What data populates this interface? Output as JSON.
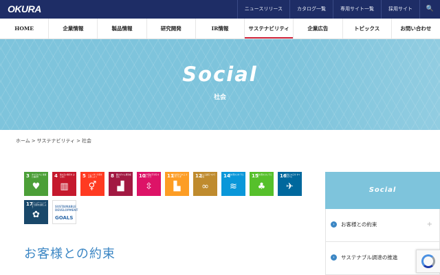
{
  "brand": {
    "logo": "OKURA"
  },
  "toplinks": [
    "ニュースリリース",
    "カタログ一覧",
    "専用サイト一覧",
    "採用サイト"
  ],
  "search_icon": "🔍",
  "nav": [
    "HOME",
    "企業情報",
    "製品情報",
    "研究開発",
    "IR情報",
    "サステナビリティ",
    "企業広告",
    "トピックス",
    "お問い合わせ"
  ],
  "hero": {
    "title": "Social",
    "subtitle": "社会"
  },
  "breadcrumb": [
    "ホーム",
    ">",
    "サステナビリティ",
    ">",
    "社会"
  ],
  "sdgs": [
    {
      "num": "3",
      "text": "すべての人に 健康と福祉を",
      "color": "#4c9f38",
      "icon": "heart-pulse-icon",
      "glyph": "♥"
    },
    {
      "num": "4",
      "text": "質の高い教育を みんなに",
      "color": "#c5192d",
      "icon": "book-icon",
      "glyph": "▥"
    },
    {
      "num": "5",
      "text": "ジェンダー平等を 実現しよう",
      "color": "#ff3a21",
      "icon": "gender-icon",
      "glyph": "⚥"
    },
    {
      "num": "8",
      "text": "働きがいも 経済成長も",
      "color": "#a21942",
      "icon": "growth-chart-icon",
      "glyph": "▟"
    },
    {
      "num": "10",
      "text": "人や国の不平等 をなくそう",
      "color": "#dd1367",
      "icon": "equality-icon",
      "glyph": "⇳"
    },
    {
      "num": "11",
      "text": "住み続けられる まちづくりを",
      "color": "#fd9d24",
      "icon": "city-icon",
      "glyph": "▙"
    },
    {
      "num": "12",
      "text": "つくる責任 つかう責任",
      "color": "#bf8b2e",
      "icon": "infinity-icon",
      "glyph": "∞"
    },
    {
      "num": "14",
      "text": "海の豊かさを 守ろう",
      "color": "#0a97d9",
      "icon": "fish-icon",
      "glyph": "≋"
    },
    {
      "num": "15",
      "text": "陸の豊かさも 守ろう",
      "color": "#56c02b",
      "icon": "tree-icon",
      "glyph": "♣"
    },
    {
      "num": "16",
      "text": "平和と公正を すべての人に",
      "color": "#00689d",
      "icon": "dove-icon",
      "glyph": "✈"
    },
    {
      "num": "17",
      "text": "パートナーシップで 目標を達成しよう",
      "color": "#19486a",
      "icon": "partnership-icon",
      "glyph": "✿"
    }
  ],
  "goals_logo": {
    "line1": "SUSTAINABLE DEVELOPMENT",
    "line2": "GOALS"
  },
  "section_title": "お客様との約束",
  "sidebar": {
    "heading": "Social",
    "items": [
      {
        "label": "お客様との約束"
      },
      {
        "label": "サステナブル調達の推進"
      }
    ]
  }
}
